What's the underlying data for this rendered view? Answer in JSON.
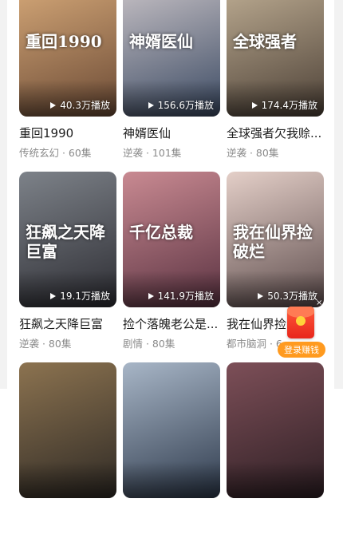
{
  "cards": [
    {
      "title": "重回1990",
      "meta": "传统玄幻 · 60集",
      "plays": "40.3万播放",
      "art": "重回1990",
      "colors": [
        "#6b4a35",
        "#d6a979"
      ]
    },
    {
      "title": "神婿医仙",
      "meta": "逆袭 · 101集",
      "plays": "156.6万播放",
      "art": "神婿医仙",
      "colors": [
        "#3b4a63",
        "#c9c3c7"
      ]
    },
    {
      "title": "全球强者欠我赊...",
      "meta": "逆袭 · 80集",
      "plays": "174.4万播放",
      "art": "全球强者",
      "colors": [
        "#4c4036",
        "#bfae94"
      ]
    },
    {
      "title": "狂飙之天降巨富",
      "meta": "逆袭 · 80集",
      "plays": "19.1万播放",
      "art": "狂飙之天降巨富",
      "colors": [
        "#2d2d33",
        "#7d8289"
      ]
    },
    {
      "title": "捡个落魄老公是...",
      "meta": "剧情 · 80集",
      "plays": "141.9万播放",
      "art": "千亿总裁",
      "colors": [
        "#5a3241",
        "#c98a92"
      ]
    },
    {
      "title": "我在仙界捡",
      "meta": "都市脑洞 · 6",
      "plays": "50.3万播放",
      "art": "我在仙界捡破烂",
      "colors": [
        "#5e4d4d",
        "#e4cfc8"
      ]
    },
    {
      "title": "",
      "meta": "",
      "plays": "",
      "art": "",
      "colors": [
        "#2f2a25",
        "#8c7350"
      ]
    },
    {
      "title": "",
      "meta": "",
      "plays": "",
      "art": "",
      "colors": [
        "#2e3a4c",
        "#a8b6c7"
      ]
    },
    {
      "title": "",
      "meta": "",
      "plays": "",
      "art": "",
      "colors": [
        "#2e1f24",
        "#7d4f58"
      ]
    }
  ],
  "promo": {
    "label": "登录赚钱",
    "close": "×"
  }
}
